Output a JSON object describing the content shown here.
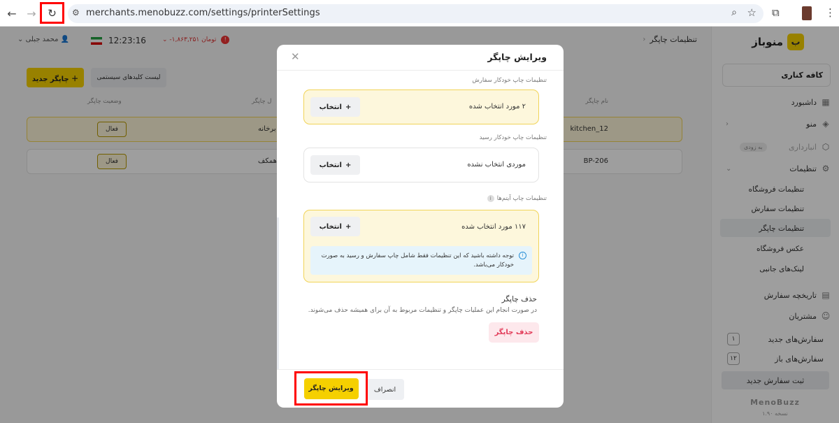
{
  "browser": {
    "back_icon": "←",
    "forward_icon": "→",
    "reload_icon": "↻",
    "tune_icon": "⚙",
    "url": "merchants.menobuzz.com/settings/printerSettings",
    "zoom_icon": "⌕",
    "star_icon": "☆",
    "extensions_icon": "⧉",
    "menu_icon": "⋮"
  },
  "sidebar": {
    "brand_logo": "ب",
    "brand": "منوباز",
    "cafe_name": "کافه کناری",
    "nav": {
      "dashboard": "داشبورد",
      "menu": "منو",
      "inventory": "انبارداری",
      "inventory_badge": "به زودی",
      "settings": "تنظیمات",
      "order_history": "تاریخچه سفارش",
      "customers": "مشتریان"
    },
    "chevron_left": "‹",
    "chevron_down": "⌄",
    "sub": {
      "store_settings": "تنظیمات فروشگاه",
      "order_settings": "تنظیمات سفارش",
      "printer_settings": "تنظیمات چاپگر",
      "store_photo": "عکس فروشگاه",
      "side_links": "لینک‌های جانبی"
    },
    "orders": {
      "new_label": "سفارش‌های جدید",
      "new_count": "۱",
      "open_label": "سفارش‌های باز",
      "open_count": "۱۲"
    },
    "new_order_btn": "ثبت سفارش جدید",
    "footer_brand": "MenoBuzz",
    "footer_version": "نسخه ۱.۹۰"
  },
  "topbar": {
    "breadcrumb": "تنظیمات چاپگر",
    "back_icon": "‹",
    "user": "⌄  محمد جبلی 👤",
    "clock": "12:23:16",
    "balance": "⌄ -۱,۸۶۳,۲۵۱ تومان",
    "alert": "!"
  },
  "page": {
    "add_printer": "＋ چاپگر جدید",
    "system_keys": "لیست کلیدهای سیستمی",
    "col_name": "نام چاپگر",
    "col_type": "ل چاپگر",
    "col_status": "وضعیت چاپگر",
    "rows": [
      {
        "name": "kitchen_12",
        "type": "برخانه",
        "status": "فعال"
      },
      {
        "name": "BP-206",
        "type": "همکف",
        "status": "فعال"
      }
    ]
  },
  "modal": {
    "title": "ویرایش چاپگر",
    "close_icon": "✕",
    "sections": {
      "auto_order_label": "تنظیمات چاپ خودکار سفارش",
      "auto_order_value": "۲ مورد انتخاب شده",
      "auto_receipt_label": "تنظیمات چاپ خودکار رسید",
      "auto_receipt_value": "موردی انتخاب نشده",
      "item_print_label": "تنظیمات چاپ آیتم‌ها",
      "item_print_value": "۱۱۷ مورد انتخاب شده",
      "info_icon": "i"
    },
    "select_label": "انتخاب",
    "plus_icon": "+",
    "notice": "توجه داشته باشید که این تنظیمات فقط شامل چاپ سفارش و رسید به صورت خودکار می‌باشد.",
    "delete_title": "حذف چاپگر",
    "delete_desc": "در صورت انجام این عملیات چاپگر و تنظیمات مربوط به آن برای همیشه حذف می‌شوند.",
    "delete_btn": "حذف چاپگر",
    "cancel_btn": "انصراف",
    "submit_btn": "ویرایش چاپگر"
  },
  "colors": {
    "accent_yellow": "#f5d000",
    "highlight_red": "#ff0000",
    "danger": "#e23d5a",
    "info_blue": "#2a8fd6"
  }
}
